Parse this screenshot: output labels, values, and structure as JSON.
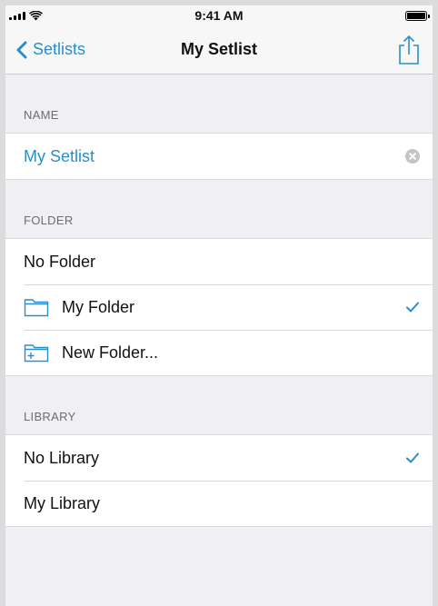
{
  "status_bar": {
    "time": "9:41 AM",
    "signal_icon": "cellular-signal-icon",
    "wifi_icon": "wifi-icon",
    "battery_icon": "battery-icon",
    "battery_level": 1.0
  },
  "nav": {
    "back_label": "Setlists",
    "title": "My Setlist",
    "share_icon": "share-icon"
  },
  "name_section": {
    "header": "NAME",
    "value": "My Setlist"
  },
  "folder_section": {
    "header": "FOLDER",
    "items": [
      {
        "label": "No Folder",
        "icon": null,
        "selected": false
      },
      {
        "label": "My Folder",
        "icon": "folder-icon",
        "selected": true
      },
      {
        "label": "New Folder...",
        "icon": "new-folder-icon",
        "selected": false
      }
    ]
  },
  "library_section": {
    "header": "LIBRARY",
    "items": [
      {
        "label": "No Library",
        "selected": true
      },
      {
        "label": "My Library",
        "selected": false
      }
    ]
  },
  "colors": {
    "accent": "#2a8fc7",
    "background": "#efeff4",
    "separator": "#d9d9de",
    "section_header_text": "#6d6d72"
  }
}
